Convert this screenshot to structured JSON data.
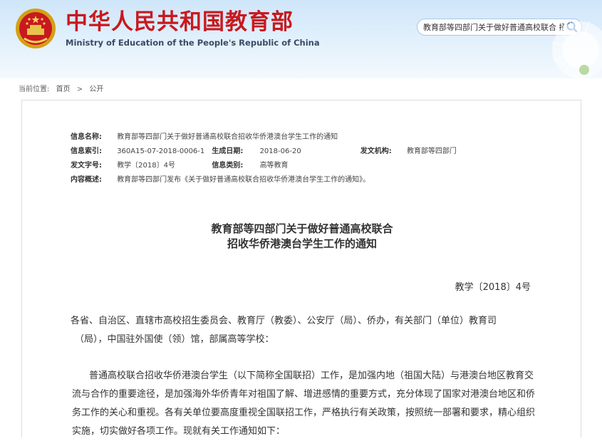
{
  "header": {
    "site_title": "中华人民共和国教育部",
    "site_subtitle": "Ministry of Education of the People's Republic of China",
    "search_value": "教育部等四部门关于做好普通高校联合 招收",
    "emblem_icon": "national-emblem-icon",
    "search_icon": "magnifier-icon",
    "brand_color": "#c8191f"
  },
  "breadcrumb": {
    "label": "当前位置:",
    "home": "首页",
    "separator": ">",
    "current": "公开"
  },
  "meta": {
    "name_label": "信息名称:",
    "name_value": "教育部等四部门关于做好普通高校联合招收华侨港澳台学生工作的通知",
    "index_label": "信息索引:",
    "index_value": "360A15-07-2018-0006-1",
    "date_label": "生成日期:",
    "date_value": "2018-06-20",
    "issuer_label": "发文机构:",
    "issuer_value": "教育部等四部门",
    "docno_label": "发文字号:",
    "docno_value": "教学〔2018〕4号",
    "category_label": "信息类别:",
    "category_value": "高等教育",
    "summary_label": "内容概述:",
    "summary_value": "教育部等四部门发布《关于做好普通高校联合招收华侨港澳台学生工作的通知》。"
  },
  "document": {
    "title_line1": "教育部等四部门关于做好普通高校联合",
    "title_line2": "招收华侨港澳台学生工作的通知",
    "doc_number": "教学〔2018〕4号",
    "addressee_line1": "各省、自治区、直辖市高校招生委员会、教育厅（教委）、公安厅（局）、侨办，有关部门（单位）教育司",
    "addressee_line2": "（局），中国驻外国使（领）馆，部属高等学校：",
    "body_line1": "普通高校联合招收华侨港澳台学生（以下简称全国联招）工作，是加强内地（祖国大陆）与港澳台地区教育交",
    "body_line2": "流与合作的重要途径，是加强海外华侨青年对祖国了解、增进感情的重要方式，充分体现了国家对港澳台地区和侨",
    "body_line3": "务工作的关心和重视。各有关单位要高度重视全国联招工作，严格执行有关政策，按照统一部署和要求，精心组织",
    "body_line4": "实施，切实做好各项工作。现就有关工作通知如下："
  }
}
